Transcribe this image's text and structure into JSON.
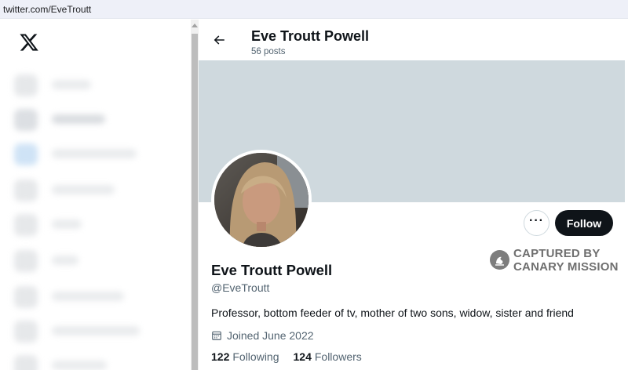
{
  "browser": {
    "url": "twitter.com/EveTroutt"
  },
  "app": {
    "logo_icon": "x-logo-icon"
  },
  "sidebar": {
    "items": [
      "blurred",
      "blurred",
      "blurred",
      "blurred",
      "blurred",
      "blurred",
      "blurred",
      "blurred",
      "blurred"
    ]
  },
  "header": {
    "back_icon": "arrow-left-icon",
    "display_name": "Eve Troutt Powell",
    "posts_count": "56 posts"
  },
  "profile": {
    "display_name": "Eve Troutt Powell",
    "handle": "@EveTroutt",
    "bio": "Professor, bottom feeder of tv, mother of two sons, widow, sister and friend",
    "joined": "Joined June 2022",
    "following_count": "122",
    "following_label": "Following",
    "followers_count": "124",
    "followers_label": "Followers"
  },
  "actions": {
    "more_icon": "more-dots-icon",
    "follow_label": "Follow"
  },
  "watermark": {
    "line1": "CAPTURED BY",
    "line2": "CANARY MISSION"
  },
  "colors": {
    "banner": "#cfd9de",
    "follow_bg": "#0f1419",
    "secondary_text": "#536471"
  }
}
